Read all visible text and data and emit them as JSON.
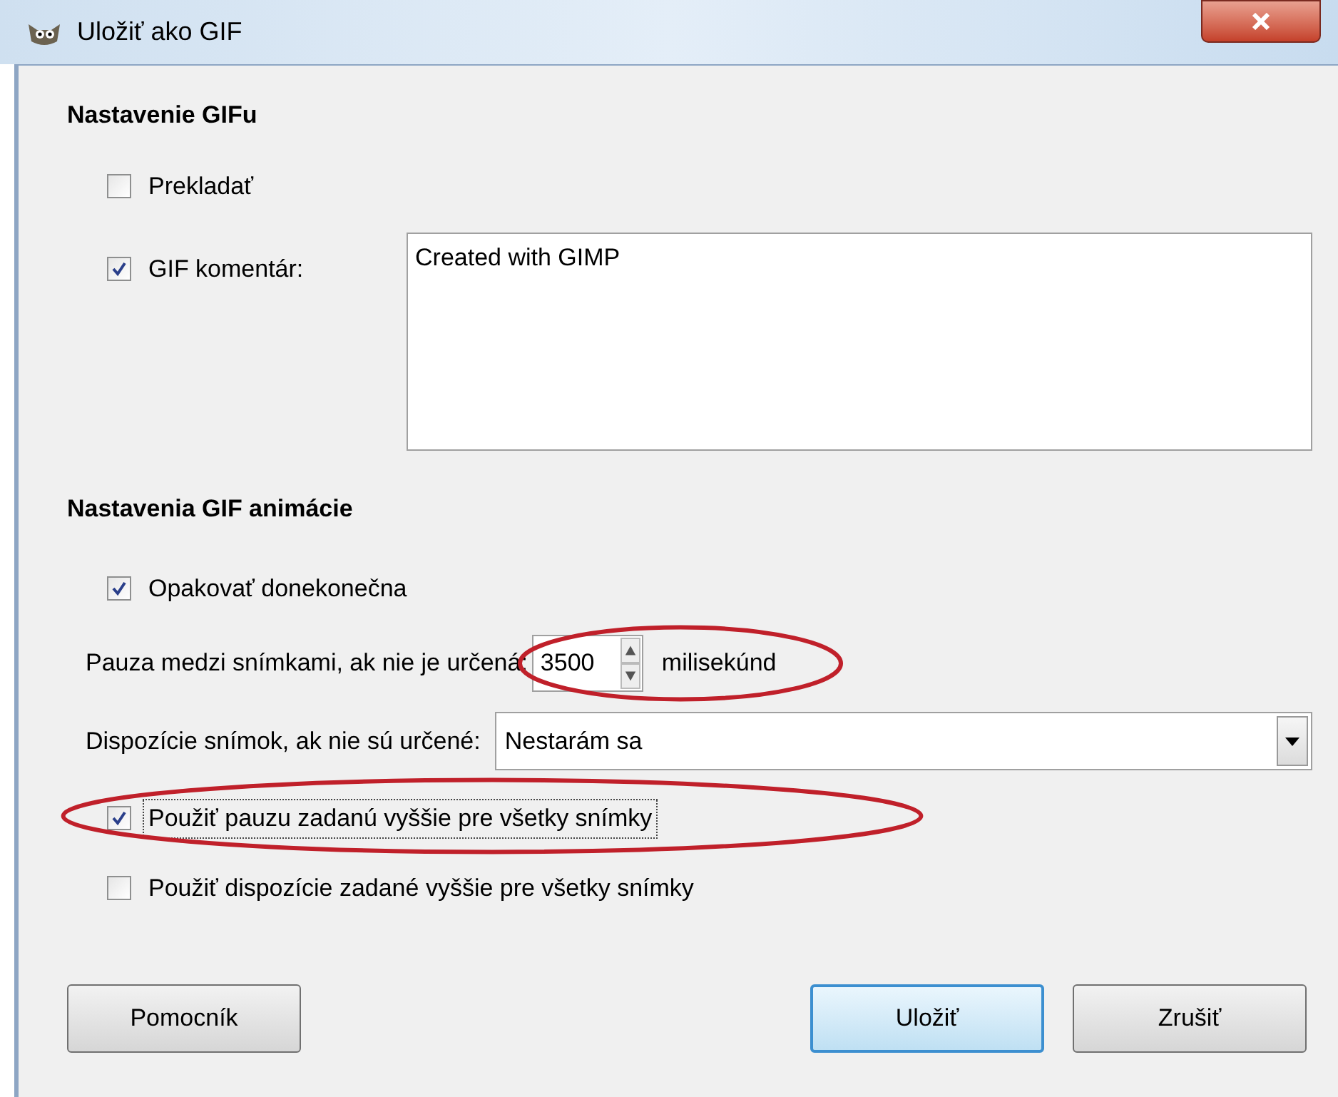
{
  "window": {
    "title": "Uložiť ako GIF"
  },
  "gif_settings": {
    "heading": "Nastavenie GIFu",
    "interlace": {
      "label": "Prekladať",
      "checked": false
    },
    "comment": {
      "label": "GIF komentár:",
      "checked": true,
      "value": "Created with GIMP"
    }
  },
  "animation_settings": {
    "heading": "Nastavenia GIF animácie",
    "loop": {
      "label": "Opakovať donekonečna",
      "checked": true
    },
    "delay": {
      "label": "Pauza medzi snímkami, ak nie je určená:",
      "value": "3500",
      "unit": "milisekúnd",
      "annotated": true
    },
    "disposal": {
      "label": "Dispozície snímok, ak nie sú určené:",
      "value": "Nestarám sa"
    },
    "options": [
      {
        "label": "Použiť pauzu zadanú vyššie pre všetky snímky",
        "checked": true,
        "focused": true,
        "annotated": true
      },
      {
        "label": "Použiť dispozície zadané vyššie pre všetky snímky",
        "checked": false,
        "focused": false,
        "annotated": false
      }
    ]
  },
  "buttons": [
    {
      "label": "Pomocník",
      "default": false
    },
    {
      "label": "Uložiť",
      "default": true
    },
    {
      "label": "Zrušiť",
      "default": false
    }
  ]
}
